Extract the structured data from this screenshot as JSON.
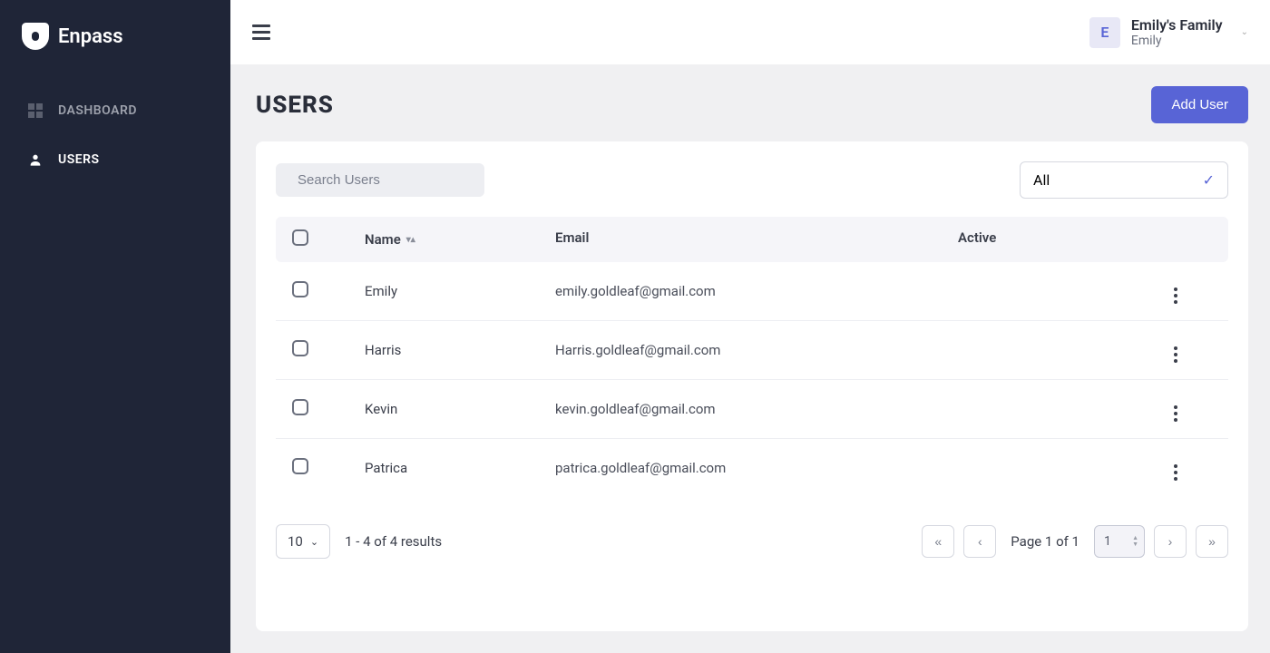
{
  "brand": {
    "name": "Enpass"
  },
  "sidebar": {
    "items": [
      {
        "label": "DASHBOARD"
      },
      {
        "label": "USERS"
      }
    ]
  },
  "header": {
    "avatar_initial": "E",
    "account_name": "Emily's Family",
    "account_sub": "Emily"
  },
  "page": {
    "title": "USERS",
    "add_button": "Add User"
  },
  "search": {
    "placeholder": "Search Users",
    "value": ""
  },
  "filter": {
    "selected": "All"
  },
  "table": {
    "headers": {
      "name": "Name",
      "email": "Email",
      "active": "Active"
    },
    "rows": [
      {
        "name": "Emily",
        "email": "emily.goldleaf@gmail.com",
        "active": true,
        "muted": true
      },
      {
        "name": "Harris",
        "email": "Harris.goldleaf@gmail.com",
        "active": true,
        "muted": false
      },
      {
        "name": "Kevin",
        "email": "kevin.goldleaf@gmail.com",
        "active": true,
        "muted": false
      },
      {
        "name": "Patrica",
        "email": "patrica.goldleaf@gmail.com",
        "active": true,
        "muted": false
      }
    ]
  },
  "footer": {
    "page_size": "10",
    "results_text": "1 - 4 of 4 results",
    "page_info": "Page 1 of 1",
    "page_input": "1",
    "first": "«",
    "prev": "‹",
    "next": "›",
    "last": "»"
  }
}
